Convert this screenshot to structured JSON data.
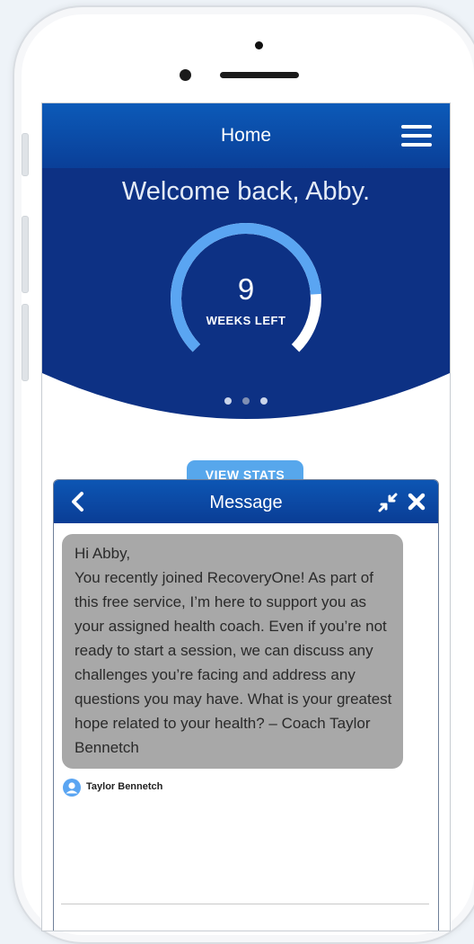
{
  "header": {
    "title": "Home"
  },
  "hero": {
    "welcome": "Welcome back, Abby.",
    "ring_value": "9",
    "ring_label": "WEEKS LEFT",
    "ring_progress": 0.82,
    "page_count": 3,
    "active_page": 2
  },
  "view_stats_label": "VIEW STATS",
  "message": {
    "title": "Message",
    "greeting": "Hi Abby,",
    "body": "You recently joined RecoveryOne! As part of this free service, I’m here to support you as your assigned health coach. Even if you’re not ready to start a session, we can discuss any challenges you’re facing and address any questions you may have. What is your greatest hope related to your health? – Coach Taylor Bennetch",
    "sender": "Taylor Bennetch"
  },
  "colors": {
    "topbar": "#0a4aa8",
    "hero_bg": "#0d3184",
    "ring_track": "#ffffff",
    "ring_progress": "#5aa5f2",
    "view_stats": "#57a7ec",
    "bubble": "#a8a8a8"
  },
  "icons": {
    "menu": "hamburger-menu-icon",
    "back": "chevron-left-icon",
    "minimize": "minimize-arrows-icon",
    "close": "close-icon",
    "avatar": "user-avatar-icon"
  }
}
